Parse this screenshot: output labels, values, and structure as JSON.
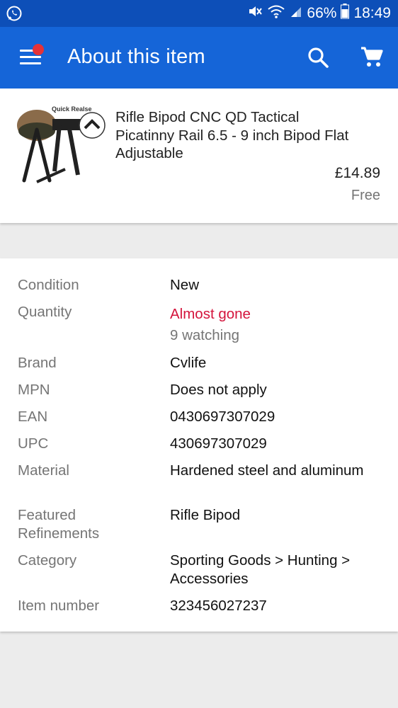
{
  "status_bar": {
    "battery": "66%",
    "time": "18:49",
    "icons": [
      "whatsapp-icon",
      "mute-icon",
      "wifi-icon",
      "signal-icon",
      "battery-icon"
    ]
  },
  "app_bar": {
    "title": "About this item",
    "icons": [
      "menu-icon",
      "search-icon",
      "cart-icon"
    ],
    "colors": {
      "bar": "#1565d8",
      "status": "#0d4fb8",
      "badge": "#e53238"
    }
  },
  "product": {
    "image_caption": "Quick Realse",
    "title": "Rifle Bipod CNC QD Tactical Picatinny Rail 6.5 - 9 inch Bipod Flat Adjustable",
    "price": "£14.89",
    "shipping": "Free"
  },
  "details": {
    "condition": {
      "label": "Condition",
      "value": "New"
    },
    "quantity": {
      "label": "Quantity",
      "value": "Almost gone",
      "sub": "9 watching"
    },
    "brand": {
      "label": "Brand",
      "value": "Cvlife"
    },
    "mpn": {
      "label": "MPN",
      "value": "Does not apply"
    },
    "ean": {
      "label": "EAN",
      "value": "0430697307029"
    },
    "upc": {
      "label": "UPC",
      "value": "430697307029"
    },
    "material": {
      "label": "Material",
      "value": "Hardened steel and aluminum"
    },
    "featured": {
      "label": "Featured Refinements",
      "value": "Rifle Bipod"
    },
    "category": {
      "label": "Category",
      "value": "Sporting Goods > Hunting > Accessories"
    },
    "item_number": {
      "label": "Item number",
      "value": "323456027237"
    }
  }
}
